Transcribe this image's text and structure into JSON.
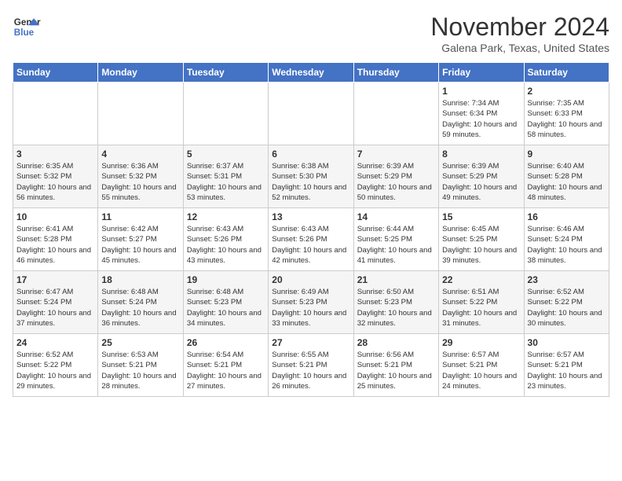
{
  "header": {
    "logo_line1": "General",
    "logo_line2": "Blue",
    "month": "November 2024",
    "location": "Galena Park, Texas, United States"
  },
  "weekdays": [
    "Sunday",
    "Monday",
    "Tuesday",
    "Wednesday",
    "Thursday",
    "Friday",
    "Saturday"
  ],
  "weeks": [
    [
      {
        "day": "",
        "info": ""
      },
      {
        "day": "",
        "info": ""
      },
      {
        "day": "",
        "info": ""
      },
      {
        "day": "",
        "info": ""
      },
      {
        "day": "",
        "info": ""
      },
      {
        "day": "1",
        "info": "Sunrise: 7:34 AM\nSunset: 6:34 PM\nDaylight: 10 hours and 59 minutes."
      },
      {
        "day": "2",
        "info": "Sunrise: 7:35 AM\nSunset: 6:33 PM\nDaylight: 10 hours and 58 minutes."
      }
    ],
    [
      {
        "day": "3",
        "info": "Sunrise: 6:35 AM\nSunset: 5:32 PM\nDaylight: 10 hours and 56 minutes."
      },
      {
        "day": "4",
        "info": "Sunrise: 6:36 AM\nSunset: 5:32 PM\nDaylight: 10 hours and 55 minutes."
      },
      {
        "day": "5",
        "info": "Sunrise: 6:37 AM\nSunset: 5:31 PM\nDaylight: 10 hours and 53 minutes."
      },
      {
        "day": "6",
        "info": "Sunrise: 6:38 AM\nSunset: 5:30 PM\nDaylight: 10 hours and 52 minutes."
      },
      {
        "day": "7",
        "info": "Sunrise: 6:39 AM\nSunset: 5:29 PM\nDaylight: 10 hours and 50 minutes."
      },
      {
        "day": "8",
        "info": "Sunrise: 6:39 AM\nSunset: 5:29 PM\nDaylight: 10 hours and 49 minutes."
      },
      {
        "day": "9",
        "info": "Sunrise: 6:40 AM\nSunset: 5:28 PM\nDaylight: 10 hours and 48 minutes."
      }
    ],
    [
      {
        "day": "10",
        "info": "Sunrise: 6:41 AM\nSunset: 5:28 PM\nDaylight: 10 hours and 46 minutes."
      },
      {
        "day": "11",
        "info": "Sunrise: 6:42 AM\nSunset: 5:27 PM\nDaylight: 10 hours and 45 minutes."
      },
      {
        "day": "12",
        "info": "Sunrise: 6:43 AM\nSunset: 5:26 PM\nDaylight: 10 hours and 43 minutes."
      },
      {
        "day": "13",
        "info": "Sunrise: 6:43 AM\nSunset: 5:26 PM\nDaylight: 10 hours and 42 minutes."
      },
      {
        "day": "14",
        "info": "Sunrise: 6:44 AM\nSunset: 5:25 PM\nDaylight: 10 hours and 41 minutes."
      },
      {
        "day": "15",
        "info": "Sunrise: 6:45 AM\nSunset: 5:25 PM\nDaylight: 10 hours and 39 minutes."
      },
      {
        "day": "16",
        "info": "Sunrise: 6:46 AM\nSunset: 5:24 PM\nDaylight: 10 hours and 38 minutes."
      }
    ],
    [
      {
        "day": "17",
        "info": "Sunrise: 6:47 AM\nSunset: 5:24 PM\nDaylight: 10 hours and 37 minutes."
      },
      {
        "day": "18",
        "info": "Sunrise: 6:48 AM\nSunset: 5:24 PM\nDaylight: 10 hours and 36 minutes."
      },
      {
        "day": "19",
        "info": "Sunrise: 6:48 AM\nSunset: 5:23 PM\nDaylight: 10 hours and 34 minutes."
      },
      {
        "day": "20",
        "info": "Sunrise: 6:49 AM\nSunset: 5:23 PM\nDaylight: 10 hours and 33 minutes."
      },
      {
        "day": "21",
        "info": "Sunrise: 6:50 AM\nSunset: 5:23 PM\nDaylight: 10 hours and 32 minutes."
      },
      {
        "day": "22",
        "info": "Sunrise: 6:51 AM\nSunset: 5:22 PM\nDaylight: 10 hours and 31 minutes."
      },
      {
        "day": "23",
        "info": "Sunrise: 6:52 AM\nSunset: 5:22 PM\nDaylight: 10 hours and 30 minutes."
      }
    ],
    [
      {
        "day": "24",
        "info": "Sunrise: 6:52 AM\nSunset: 5:22 PM\nDaylight: 10 hours and 29 minutes."
      },
      {
        "day": "25",
        "info": "Sunrise: 6:53 AM\nSunset: 5:21 PM\nDaylight: 10 hours and 28 minutes."
      },
      {
        "day": "26",
        "info": "Sunrise: 6:54 AM\nSunset: 5:21 PM\nDaylight: 10 hours and 27 minutes."
      },
      {
        "day": "27",
        "info": "Sunrise: 6:55 AM\nSunset: 5:21 PM\nDaylight: 10 hours and 26 minutes."
      },
      {
        "day": "28",
        "info": "Sunrise: 6:56 AM\nSunset: 5:21 PM\nDaylight: 10 hours and 25 minutes."
      },
      {
        "day": "29",
        "info": "Sunrise: 6:57 AM\nSunset: 5:21 PM\nDaylight: 10 hours and 24 minutes."
      },
      {
        "day": "30",
        "info": "Sunrise: 6:57 AM\nSunset: 5:21 PM\nDaylight: 10 hours and 23 minutes."
      }
    ]
  ]
}
